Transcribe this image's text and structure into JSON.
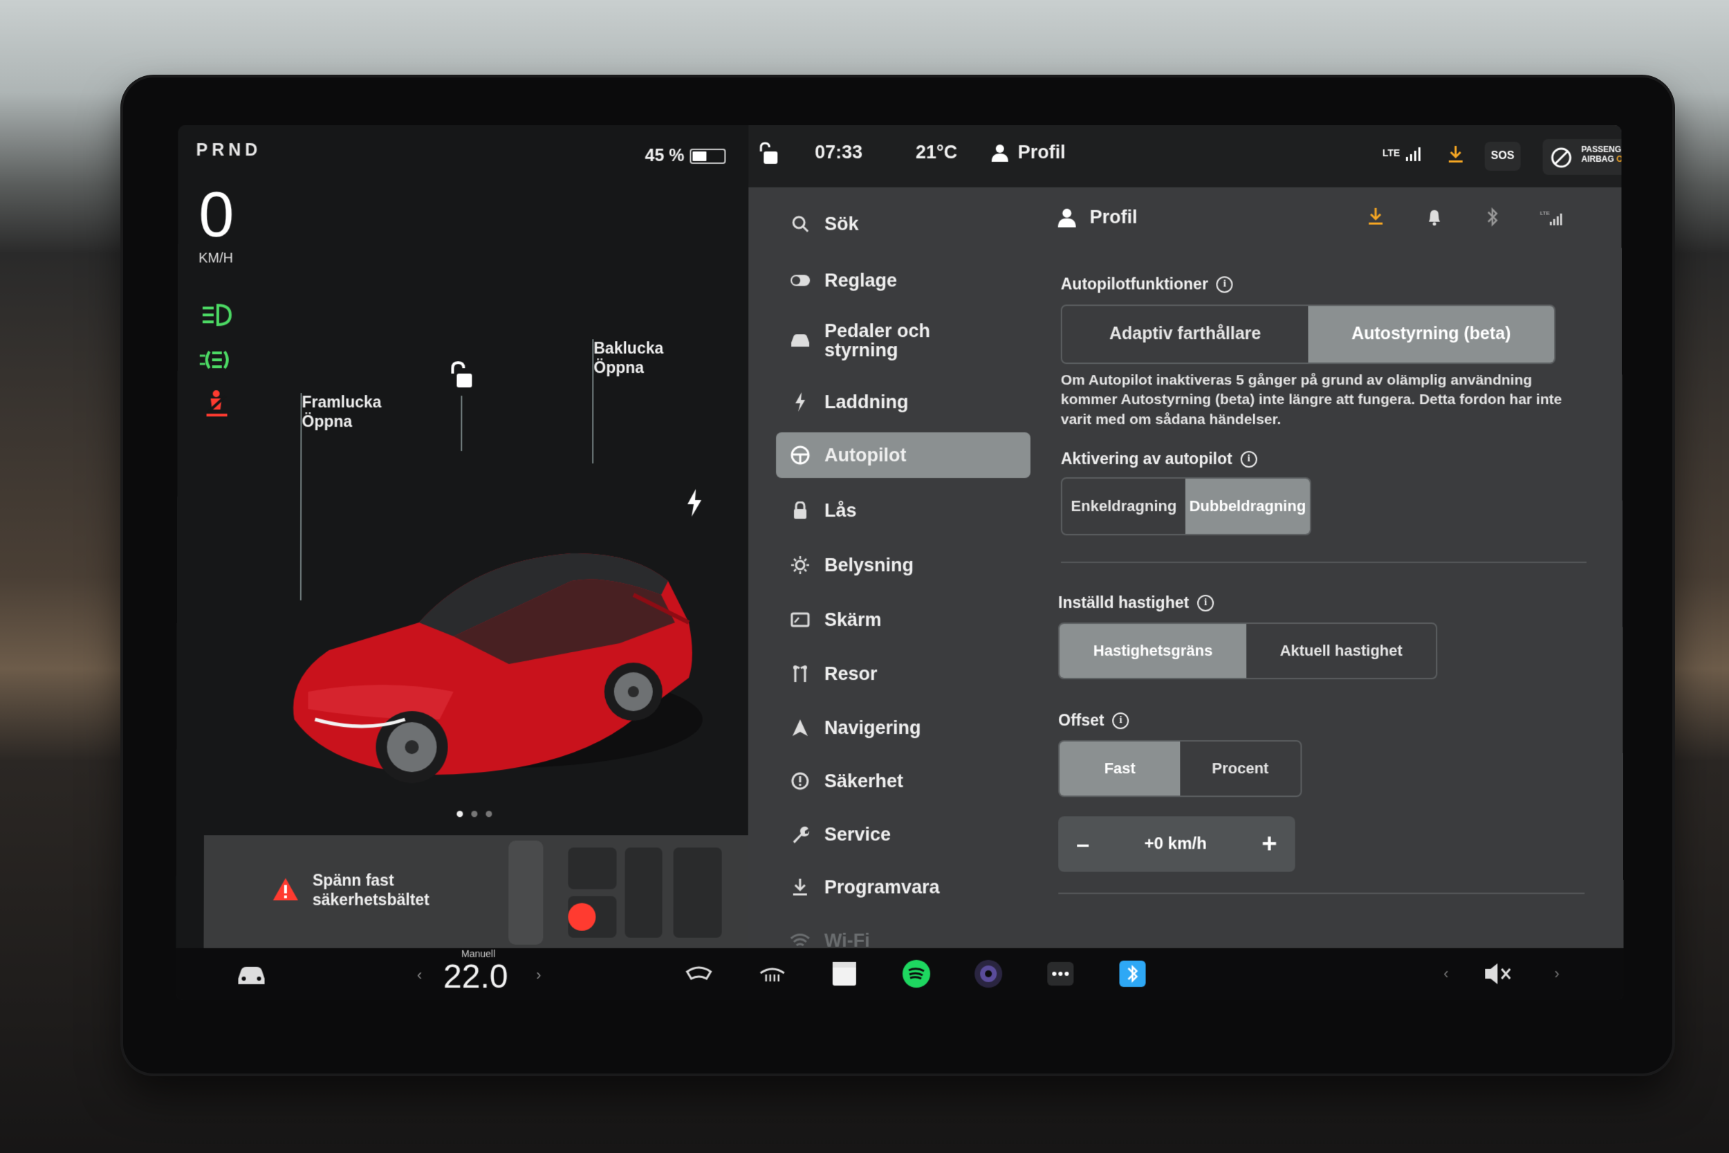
{
  "drive": {
    "gears": "PRND",
    "speed": "0",
    "speed_unit": "KM/H",
    "battery_percent": "45 %",
    "battery_level": 0.45
  },
  "car_view": {
    "frunk": {
      "label": "Framlucka",
      "action": "Öppna"
    },
    "trunk": {
      "label": "Baklucka",
      "action": "Öppna"
    },
    "page_dots": 3,
    "active_dot": 0
  },
  "alert": {
    "line1": "Spänn fast",
    "line2": "säkerhetsbältet"
  },
  "status": {
    "time": "07:33",
    "temperature": "21°C",
    "profile": "Profil",
    "network": "LTE",
    "sos": "SOS",
    "airbag_line1": "PASSENGER",
    "airbag_line2": "AIRBAG",
    "airbag_state": "ON"
  },
  "menu": [
    {
      "label": "Sök",
      "icon": "search-icon"
    },
    {
      "label": "Reglage",
      "icon": "toggle-icon"
    },
    {
      "label": "Pedaler och styrning",
      "icon": "car-icon"
    },
    {
      "label": "Laddning",
      "icon": "bolt-icon"
    },
    {
      "label": "Autopilot",
      "icon": "steering-wheel-icon"
    },
    {
      "label": "Lås",
      "icon": "lock-icon"
    },
    {
      "label": "Belysning",
      "icon": "sun-icon"
    },
    {
      "label": "Skärm",
      "icon": "display-icon"
    },
    {
      "label": "Resor",
      "icon": "trips-icon"
    },
    {
      "label": "Navigering",
      "icon": "navigation-icon"
    },
    {
      "label": "Säkerhet",
      "icon": "safety-icon"
    },
    {
      "label": "Service",
      "icon": "wrench-icon"
    },
    {
      "label": "Programvara",
      "icon": "download-icon"
    },
    {
      "label": "Wi-Fi",
      "icon": "wifi-icon"
    }
  ],
  "autopilot": {
    "header": "Profil",
    "features_title": "Autopilotfunktioner",
    "features_options": [
      "Adaptiv farthållare",
      "Autostyrning (beta)"
    ],
    "features_selected": 1,
    "note": "Om Autopilot inaktiveras 5 gånger på grund av olämplig användning kommer Autostyrning (beta) inte längre att fungera. Detta fordon har inte varit med om sådana händelser.",
    "activation_title": "Aktivering av autopilot",
    "activation_options": [
      "Enkeldragning",
      "Dubbeldragning"
    ],
    "activation_selected": 1,
    "speed_title": "Inställd hastighet",
    "speed_options": [
      "Hastighetsgräns",
      "Aktuell hastighet"
    ],
    "speed_selected": 0,
    "offset_title": "Offset",
    "offset_options": [
      "Fast",
      "Procent"
    ],
    "offset_selected": 0,
    "offset_value": "+0 km/h",
    "minus": "–",
    "plus": "+"
  },
  "dock": {
    "climate_mode": "Manuell",
    "cabin_temp": "22.0"
  },
  "colors": {
    "accent_green": "#4cd964",
    "alert_red": "#ff3b30",
    "download_orange": "#f5a623",
    "car_red": "#c9121c",
    "bluetooth_blue": "#2ea8f5",
    "spotify_green": "#1ed760"
  }
}
